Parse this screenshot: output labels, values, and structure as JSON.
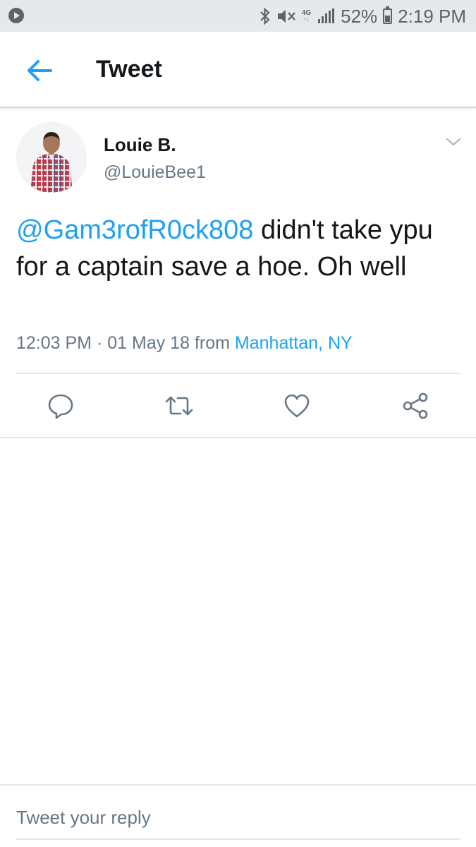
{
  "status_bar": {
    "network": "4G",
    "battery_percent": "52%",
    "battery_level": 0.52,
    "time": "2:19 PM",
    "icons": [
      "app-icon",
      "bluetooth-icon",
      "mute-icon",
      "lte-icon",
      "signal-icon",
      "battery-icon"
    ]
  },
  "app_bar": {
    "title": "Tweet",
    "back_icon": "arrow-left-icon"
  },
  "tweet": {
    "author_name": "Louie B.",
    "author_handle": "@LouieBee1",
    "mention": "@Gam3rofR0ck808",
    "text": " didn't take ypu for a captain save a hoe. Oh well",
    "time": "12:03 PM",
    "separator": "·",
    "date": "01 May 18",
    "from_label": "from",
    "place": "Manhattan, NY",
    "caret_icon": "chevron-down-icon"
  },
  "actions": [
    "reply-icon",
    "retweet-icon",
    "like-icon",
    "share-icon"
  ],
  "reply_bar": {
    "placeholder": "Tweet your reply"
  },
  "colors": {
    "accent": "#1da1f2",
    "secondary_text": "#657786",
    "primary_text": "#14171a",
    "status_bar_bg": "#e7e8ea",
    "divider": "#e1e8ed"
  }
}
